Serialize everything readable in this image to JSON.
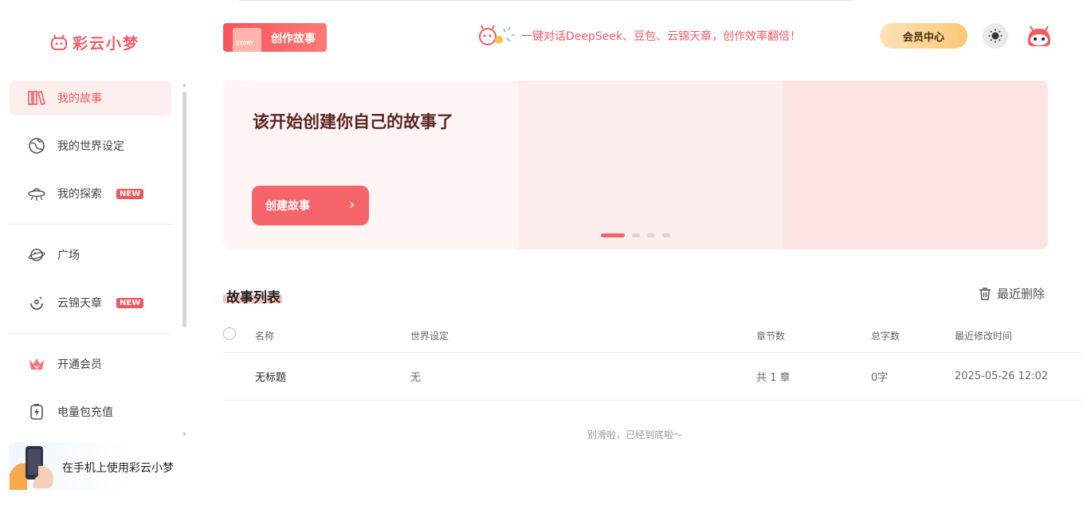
{
  "app": {
    "name": "彩云小梦"
  },
  "sidebar": {
    "items": [
      {
        "label": "我的故事",
        "icon": "books-icon"
      },
      {
        "label": "我的世界设定",
        "icon": "globe-icon"
      },
      {
        "label": "我的探索",
        "icon": "ufo-icon",
        "badge": "NEW"
      },
      {
        "label": "广场",
        "icon": "planet-icon"
      },
      {
        "label": "云锦天章",
        "icon": "swirl-icon",
        "badge": "NEW"
      },
      {
        "label": "开通会员",
        "icon": "crown-icon"
      },
      {
        "label": "电量包充值",
        "icon": "battery-charge-icon"
      }
    ],
    "mobile_promo": "在手机上使用彩云小梦"
  },
  "header": {
    "create_story": "创作故事",
    "story_tag": "STORY",
    "promo_text": "一键对话DeepSeek、豆包、云锦天章，创作效率翻倍！",
    "vip_center": "会员中心"
  },
  "banner": {
    "title": "该开始创建你自己的故事了",
    "button": "创建故事",
    "slides": 4,
    "active_slide": 1
  },
  "story_list": {
    "title": "故事列表",
    "recent_delete": "最近删除",
    "columns": [
      "名称",
      "世界设定",
      "章节数",
      "总字数",
      "最近修改时间"
    ],
    "rows": [
      {
        "name": "无标题",
        "world": "无",
        "chapters": "共 1 章",
        "words": "0字",
        "modified": "2025-05-26 12:02"
      }
    ],
    "end_note": "别滑啦，已经到底啦～"
  },
  "colors": {
    "accent": "#f05a63",
    "active_bg": "#fdeeee",
    "vip_gold": "#f9c878"
  }
}
